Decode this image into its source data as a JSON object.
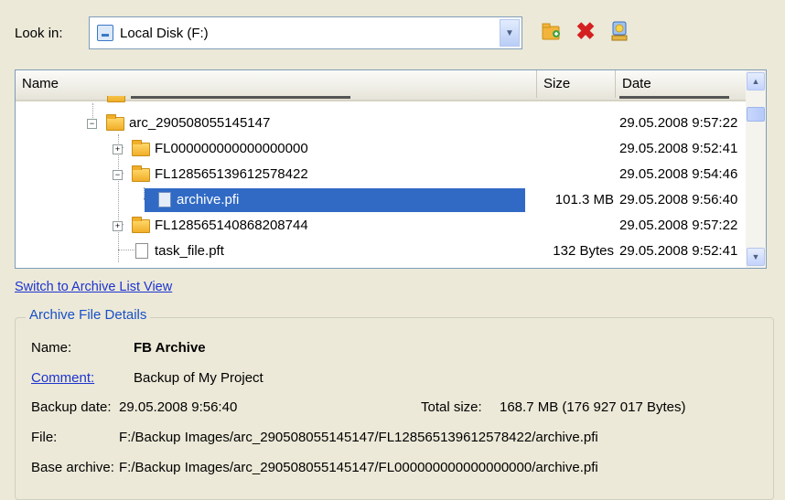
{
  "look_in": {
    "label": "Look in:",
    "value": "Local Disk (F:)"
  },
  "toolbar": {
    "new_folder_icon": "new-folder-icon",
    "delete_icon": "delete-icon",
    "properties_icon": "properties-icon"
  },
  "columns": {
    "name": "Name",
    "size": "Size",
    "date": "Date"
  },
  "tree": [
    {
      "name": "arc_290508055145147",
      "size": "",
      "date": "29.05.2008 9:57:22",
      "type": "folder",
      "expanded": true
    },
    {
      "name": "FL000000000000000000",
      "size": "",
      "date": "29.05.2008 9:52:41",
      "type": "folder",
      "expanded": false
    },
    {
      "name": "FL128565139612578422",
      "size": "",
      "date": "29.05.2008 9:54:46",
      "type": "folder",
      "expanded": true
    },
    {
      "name": "archive.pfi",
      "size": "101.3 MB",
      "date": "29.05.2008 9:56:40",
      "type": "archive",
      "selected": true
    },
    {
      "name": "FL128565140868208744",
      "size": "",
      "date": "29.05.2008 9:57:22",
      "type": "folder",
      "expanded": false
    },
    {
      "name": "task_file.pft",
      "size": "132 Bytes",
      "date": "29.05.2008 9:52:41",
      "type": "file"
    }
  ],
  "switch_link": "Switch to Archive List View",
  "details": {
    "title": "Archive File Details",
    "name_label": "Name:",
    "name_value": "FB Archive",
    "comment_label": "Comment:",
    "comment_value": "Backup of My Project",
    "backup_date_label": "Backup date:",
    "backup_date_value": "29.05.2008 9:56:40",
    "total_size_label": "Total size:",
    "total_size_value": "168.7 MB (176 927 017 Bytes)",
    "file_label": "File:",
    "file_value": "F:/Backup Images/arc_290508055145147/FL128565139612578422/archive.pfi",
    "base_label": "Base archive:",
    "base_value": "F:/Backup Images/arc_290508055145147/FL000000000000000000/archive.pfi"
  },
  "colors": {
    "selection": "#316ac5",
    "link": "#1d34cf",
    "group_title": "#1850c8",
    "background": "#ece9d8"
  }
}
